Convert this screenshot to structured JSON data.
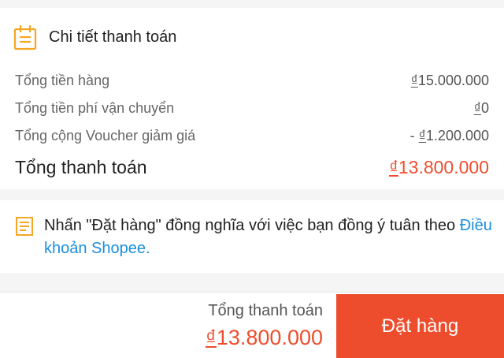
{
  "payment_details": {
    "title": "Chi tiết thanh toán",
    "icon": "invoice-icon",
    "rows": [
      {
        "label": "Tổng tiền hàng",
        "currency": "₫",
        "amount": "15.000.000"
      },
      {
        "label": "Tổng tiền phí vận chuyển",
        "currency": "₫",
        "amount": "0"
      },
      {
        "label": "Tổng cộng Voucher giảm giá",
        "prefix": "- ",
        "currency": "₫",
        "amount": "1.200.000"
      }
    ],
    "total": {
      "label": "Tổng thanh toán",
      "currency": "₫",
      "amount": "13.800.000"
    }
  },
  "terms": {
    "icon": "document-icon",
    "text": "Nhấn \"Đặt hàng\" đồng nghĩa với việc bạn đồng ý tuân theo ",
    "link": "Điều khoản Shopee."
  },
  "bottom_bar": {
    "total_label": "Tổng thanh toán",
    "currency": "₫",
    "total_amount": "13.800.000",
    "order_button": "Đặt hàng"
  },
  "colors": {
    "accent": "#ee4d2d",
    "icon": "#f5a623",
    "link": "#1a8fe0"
  }
}
